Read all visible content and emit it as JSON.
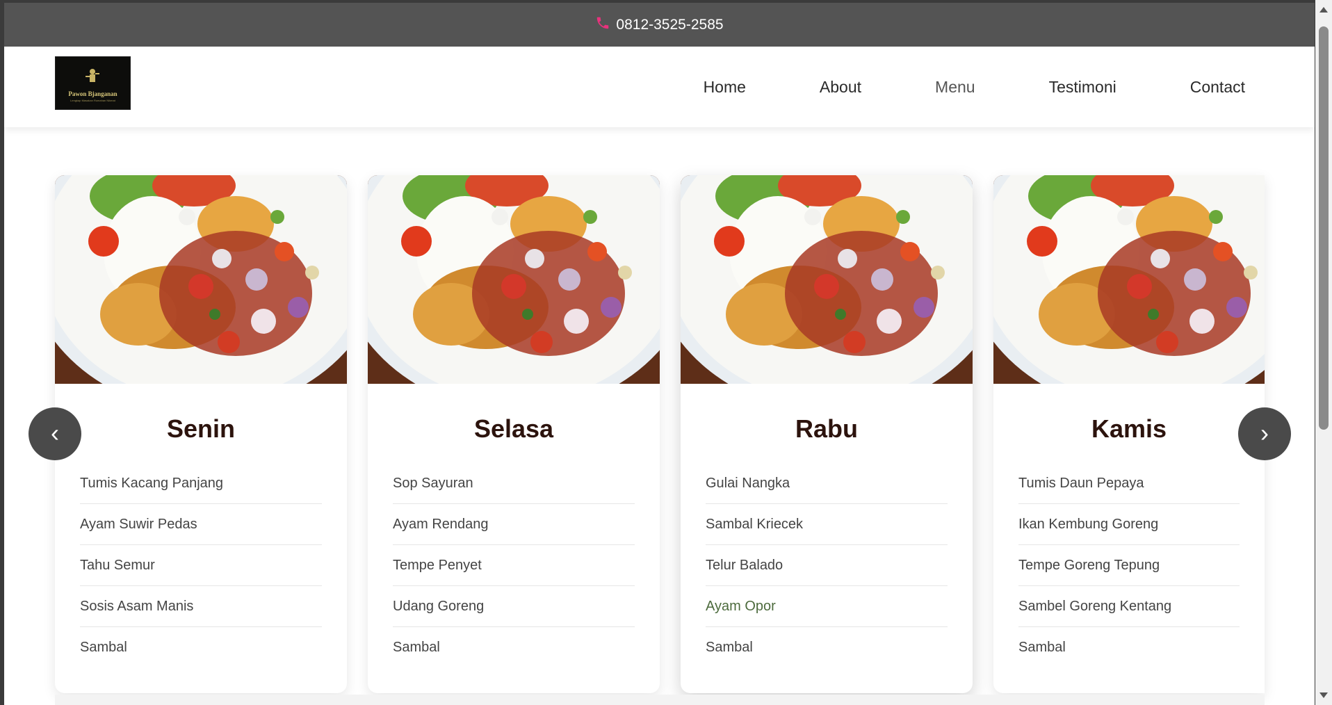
{
  "topbar": {
    "phone_icon": "phone-icon",
    "phone": "0812-3525-2585",
    "accent": "#e8327c"
  },
  "nav": {
    "logo": {
      "brand": "Pawon Bjanganan",
      "tag": "Lengkap Masakan Rumahan Nikmat"
    },
    "links": [
      "Home",
      "About",
      "Menu",
      "Testimoni",
      "Contact"
    ]
  },
  "carousel": {
    "prev": "‹",
    "next": "›",
    "cards": [
      {
        "day": "Senin",
        "items": [
          "Tumis Kacang Panjang",
          "Ayam Suwir Pedas",
          "Tahu Semur",
          "Sosis Asam Manis",
          "Sambal"
        ]
      },
      {
        "day": "Selasa",
        "items": [
          "Sop Sayuran",
          "Ayam Rendang",
          "Tempe Penyet",
          "Udang Goreng",
          "Sambal"
        ]
      },
      {
        "day": "Rabu",
        "items": [
          "Gulai Nangka",
          "Sambal Kriecek",
          "Telur Balado",
          "Ayam Opor",
          "Sambal"
        ]
      },
      {
        "day": "Kamis",
        "items": [
          "Tumis Daun Pepaya",
          "Ikan Kembung Goreng",
          "Tempe Goreng Tepung",
          "Sambel Goreng Kentang",
          "Sambal"
        ]
      }
    ]
  }
}
